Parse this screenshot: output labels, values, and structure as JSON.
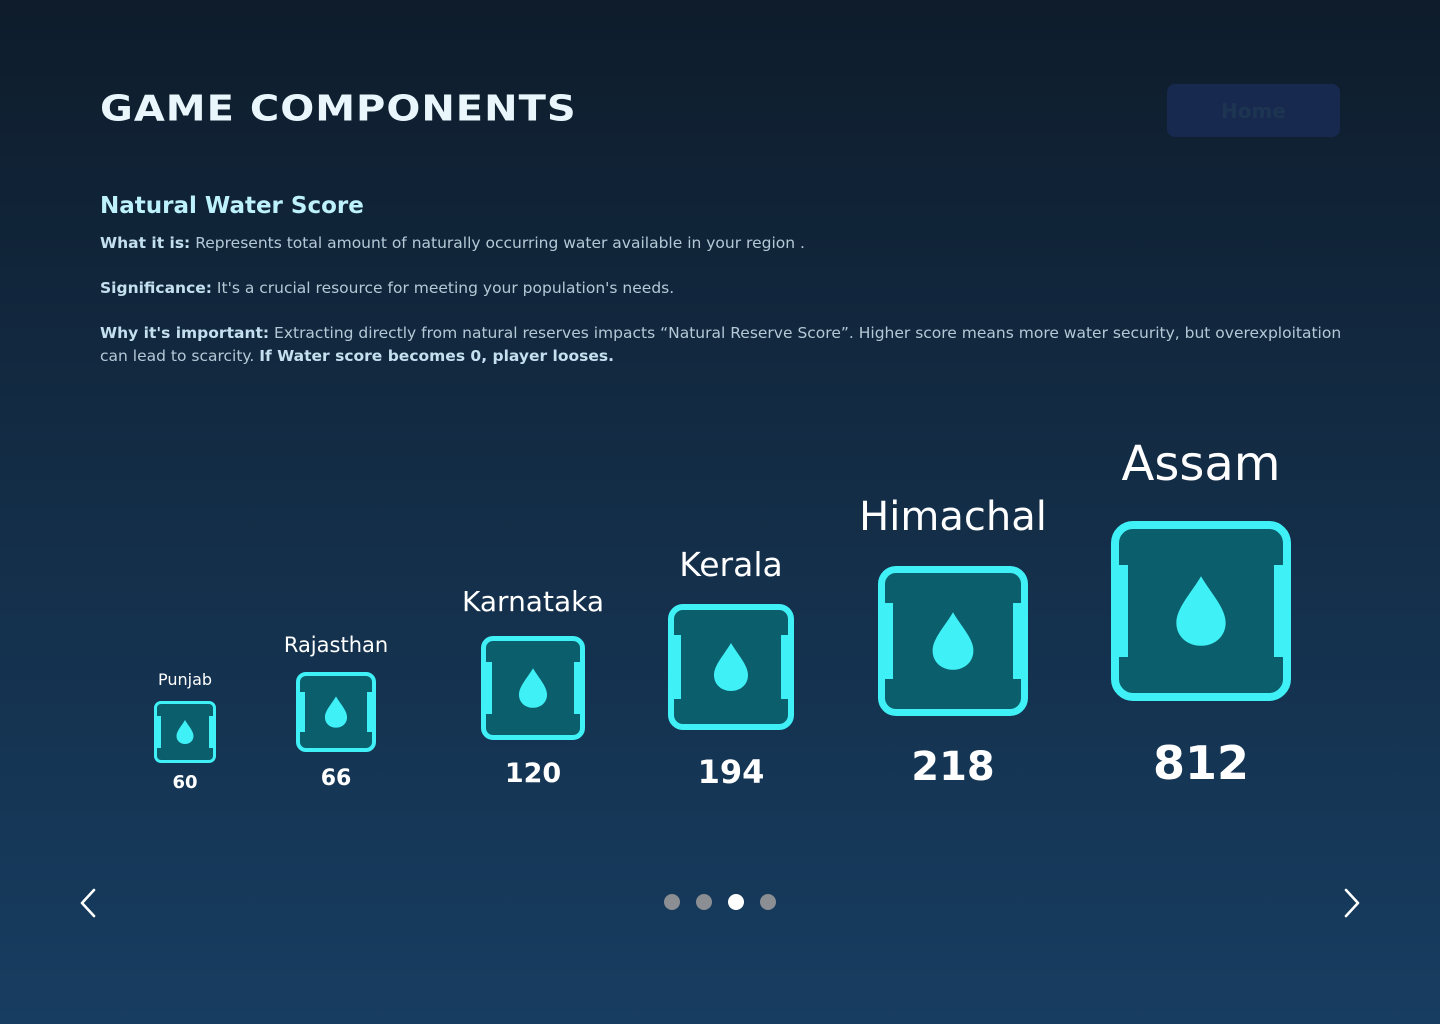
{
  "header": {
    "title": "GAME COMPONENTS",
    "home_label": "Home"
  },
  "section": {
    "title": "Natural Water Score",
    "what_label": "What it is:",
    "what_text": " Represents total amount of naturally occurring water available in your region .",
    "significance_label": "Significance:",
    "significance_text": " It's a crucial resource for meeting your population's needs.",
    "why_label": "Why it's important:",
    "why_text": "  Extracting directly from natural reserves impacts “Natural Reserve Score”. Higher score means more water security, but overexploitation can lead to scarcity. ",
    "why_emphasis": "If Water score becomes 0, player looses."
  },
  "tiers": [
    {
      "name": "Punjab",
      "score": "60"
    },
    {
      "name": "Rajasthan",
      "score": "66"
    },
    {
      "name": "Karnataka",
      "score": "120"
    },
    {
      "name": "Kerala",
      "score": "194"
    },
    {
      "name": "Himachal",
      "score": "218"
    },
    {
      "name": "Assam",
      "score": "812"
    }
  ],
  "icons": {
    "tile_icon": "water-drop-icon",
    "prev": "chevron-left-icon",
    "next": "chevron-right-icon"
  },
  "pagination": {
    "total": 4,
    "active_index": 2
  },
  "colors": {
    "accent": "#3ff0f6",
    "tile_fill": "#0b5e6b",
    "title_color": "#bdf1fb",
    "home_button_bg": "#17294f"
  }
}
